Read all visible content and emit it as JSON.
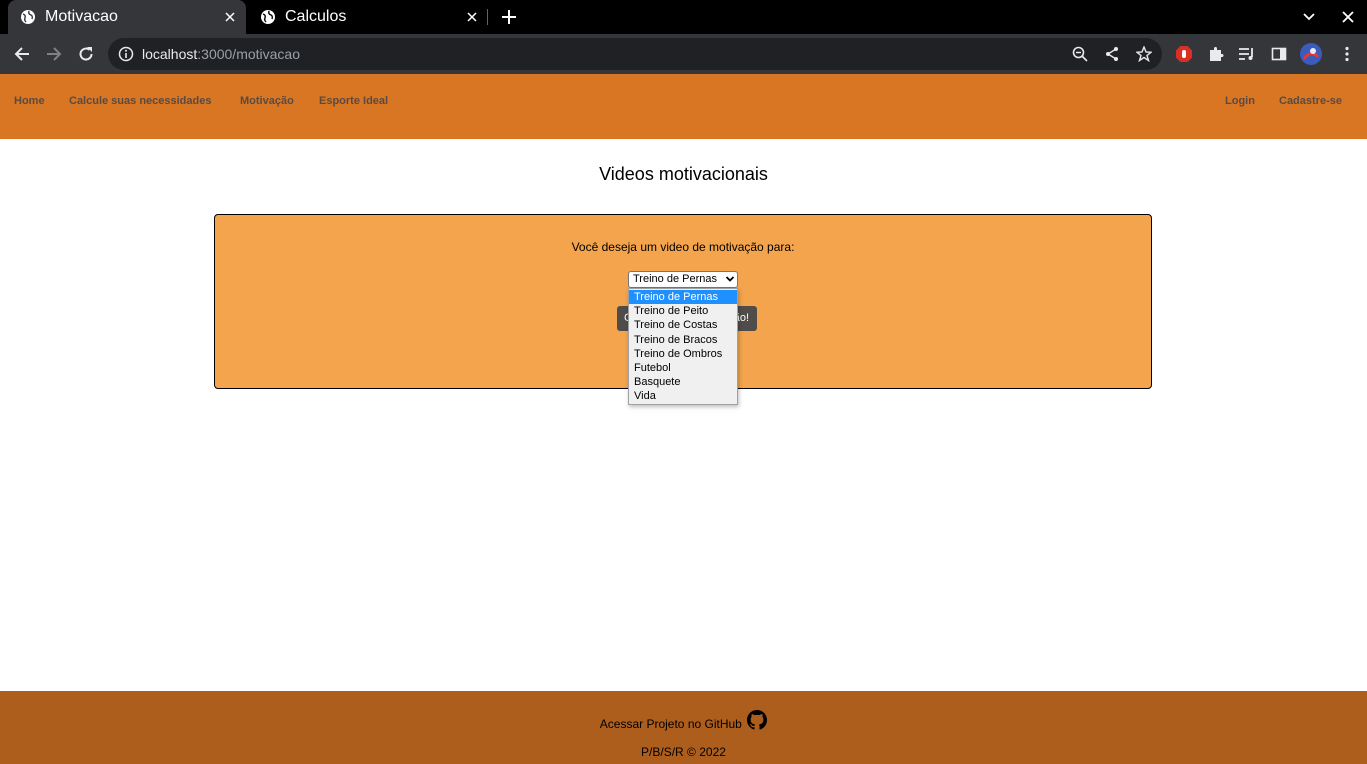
{
  "browser": {
    "tabs": [
      {
        "title": "Motivacao",
        "active": true
      },
      {
        "title": "Calculos",
        "active": false
      }
    ],
    "url_host": "localhost",
    "url_rest": ":3000/motivacao"
  },
  "nav": {
    "left": [
      "Home",
      "Calcule suas necessidades",
      "Motivação",
      "Esporte Ideal"
    ],
    "right": [
      "Login",
      "Cadastre-se"
    ]
  },
  "main": {
    "title": "Videos motivacionais",
    "question": "Você deseja um video de motivação para:",
    "select_value": "Treino de Pernas",
    "options": [
      "Treino de Pernas",
      "Treino de Peito",
      "Treino de Costas",
      "Treino de Bracos",
      "Treino de Ombros",
      "Futebol",
      "Basquete",
      "Vida"
    ],
    "button_visible_start": "C",
    "button_visible_end": "ão!"
  },
  "footer": {
    "github_text": "Acessar Projeto no GitHub",
    "copyright": "P/B/S/R © 2022"
  },
  "colors": {
    "nav_bg": "#d97624",
    "card_bg": "#f3a44c",
    "footer_bg": "#ad5e1c",
    "button_bg": "#4f4c4a",
    "selected_option": "#1e90ff"
  }
}
